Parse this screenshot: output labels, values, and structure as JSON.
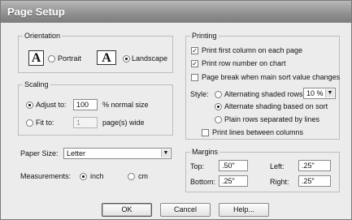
{
  "window": {
    "title": "Page Setup"
  },
  "orientation": {
    "legend": "Orientation",
    "portrait_label": "Portrait",
    "landscape_label": "Landscape",
    "icon_letter": "A"
  },
  "scaling": {
    "legend": "Scaling",
    "adjust_label": "Adjust to:",
    "adjust_value": "100",
    "adjust_suffix": "% normal size",
    "fit_label": "Fit to:",
    "fit_value": "1",
    "fit_suffix": "page(s) wide"
  },
  "paper": {
    "label": "Paper Size:",
    "value": "Letter"
  },
  "measurements": {
    "label": "Measurements:",
    "inch_label": "inch",
    "cm_label": "cm"
  },
  "printing": {
    "legend": "Printing",
    "first_column_label": "Print first column on each page",
    "row_number_label": "Print row number on chart",
    "page_break_label": "Page break when main sort value changes",
    "style_label": "Style:",
    "alt_rows_label": "Alternating shaded rows",
    "alt_rows_value": "10 %",
    "alt_sort_label": "Alternate shading based on sort",
    "plain_rows_label": "Plain rows separated by lines",
    "print_lines_label": "Print lines between columns",
    "check_mark": "✓"
  },
  "margins": {
    "legend": "Margins",
    "top_label": "Top:",
    "top_value": ".50\"",
    "left_label": "Left:",
    "left_value": ".25\"",
    "bottom_label": "Bottom:",
    "bottom_value": ".25\"",
    "right_label": "Right:",
    "right_value": ".25\""
  },
  "buttons": {
    "ok": "OK",
    "cancel": "Cancel",
    "help": "Help..."
  }
}
